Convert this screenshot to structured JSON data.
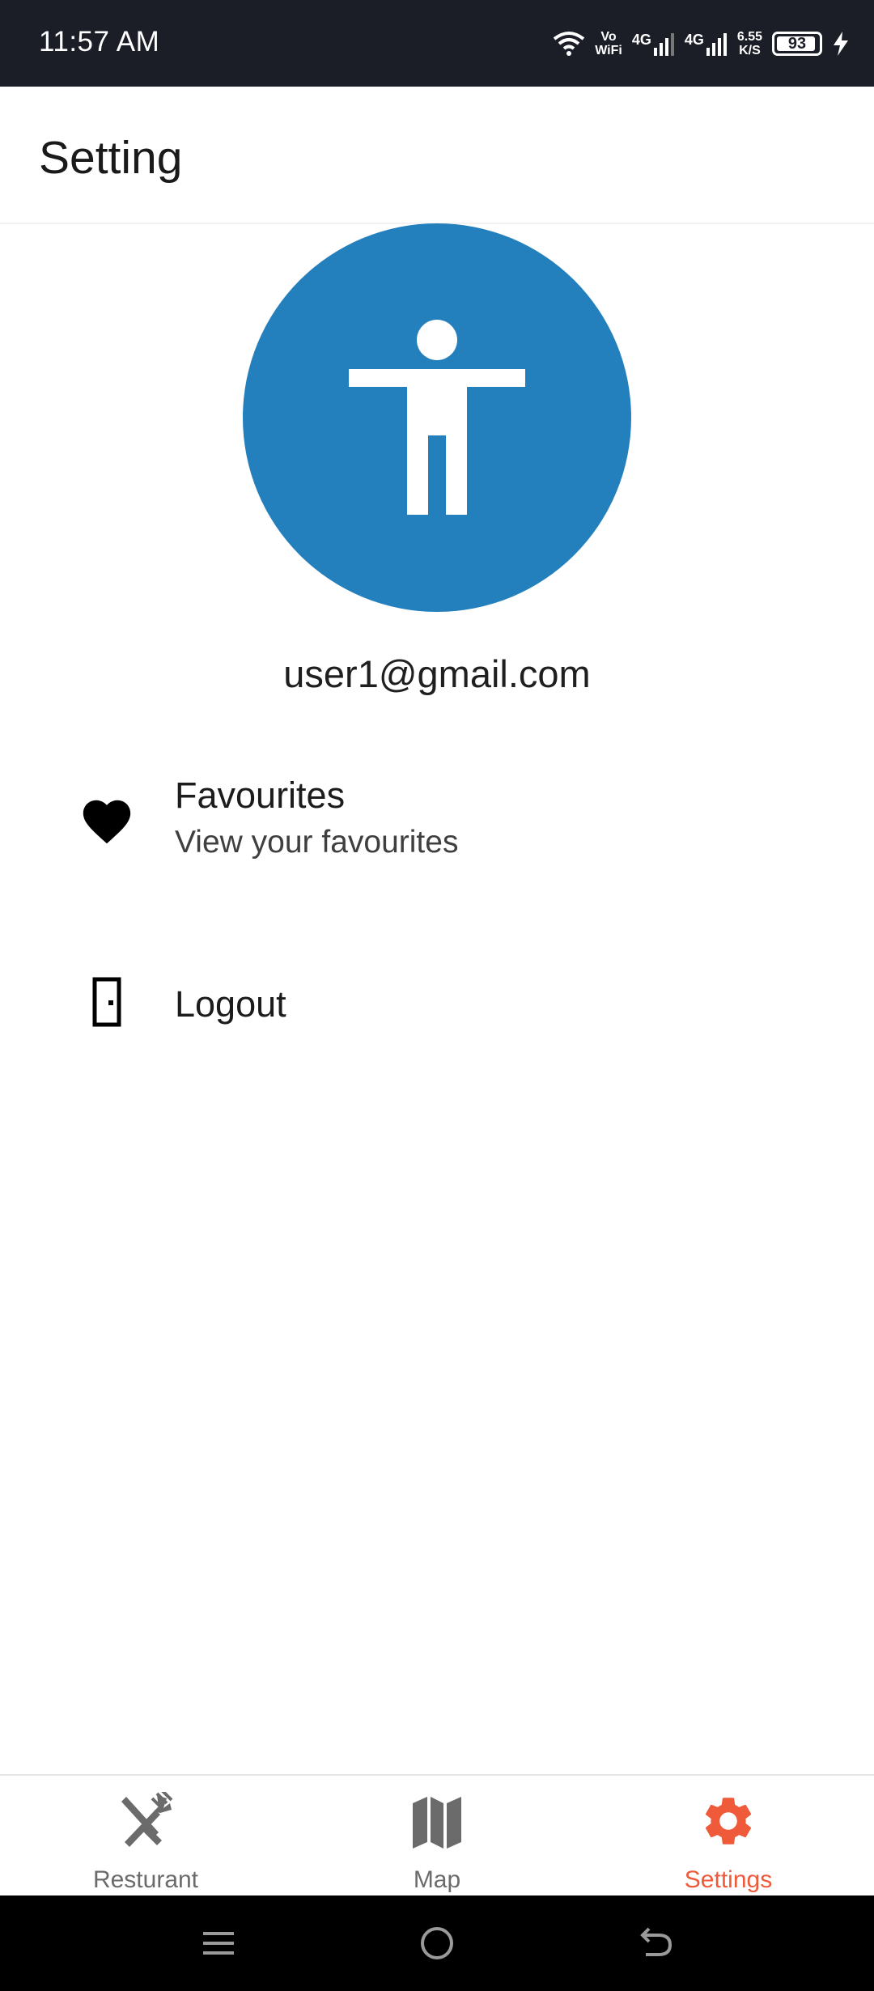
{
  "status_bar": {
    "time": "11:57 AM",
    "vo_wifi_top": "Vo",
    "vo_wifi_bottom": "WiFi",
    "network1_label": "4G",
    "network2_label": "4G",
    "speed_value": "6.55",
    "speed_unit": "K/S",
    "battery_level": "93",
    "battery_fraction": 0.93,
    "icons": [
      "wifi-icon",
      "signal-icon",
      "battery-icon",
      "charging-icon"
    ]
  },
  "app_bar": {
    "title": "Setting"
  },
  "profile": {
    "avatar_icon": "accessibility-person-icon",
    "avatar_color": "#2380bd",
    "email": "user1@gmail.com"
  },
  "menu": {
    "favourites": {
      "icon": "heart-icon",
      "title": "Favourites",
      "subtitle": "View your favourites"
    },
    "logout": {
      "icon": "door-icon",
      "title": "Logout"
    }
  },
  "bottom_nav": {
    "items": [
      {
        "label": "Resturant",
        "icon": "fork-knife-icon",
        "active": false
      },
      {
        "label": "Map",
        "icon": "map-icon",
        "active": false
      },
      {
        "label": "Settings",
        "icon": "gear-icon",
        "active": true
      }
    ],
    "active_color": "#ee5a3a",
    "inactive_color": "#6b6b6b"
  },
  "system_nav": {
    "icons": [
      "menu-icon",
      "home-icon",
      "back-icon"
    ]
  }
}
